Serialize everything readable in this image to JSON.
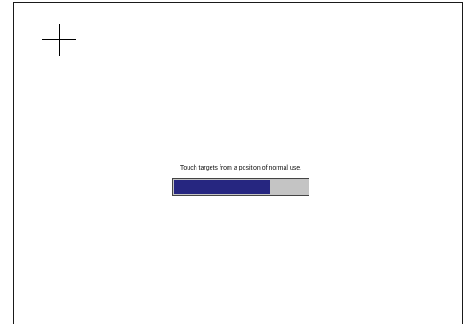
{
  "calibration": {
    "instruction": "Touch targets from a position of normal use.",
    "progress_fraction": 0.72
  },
  "colors": {
    "progress_fill": "#262680",
    "progress_track": "#c4c4c4",
    "background": "#ffffff",
    "crosshair": "#000000"
  },
  "icons": {
    "target": "crosshair-icon"
  }
}
